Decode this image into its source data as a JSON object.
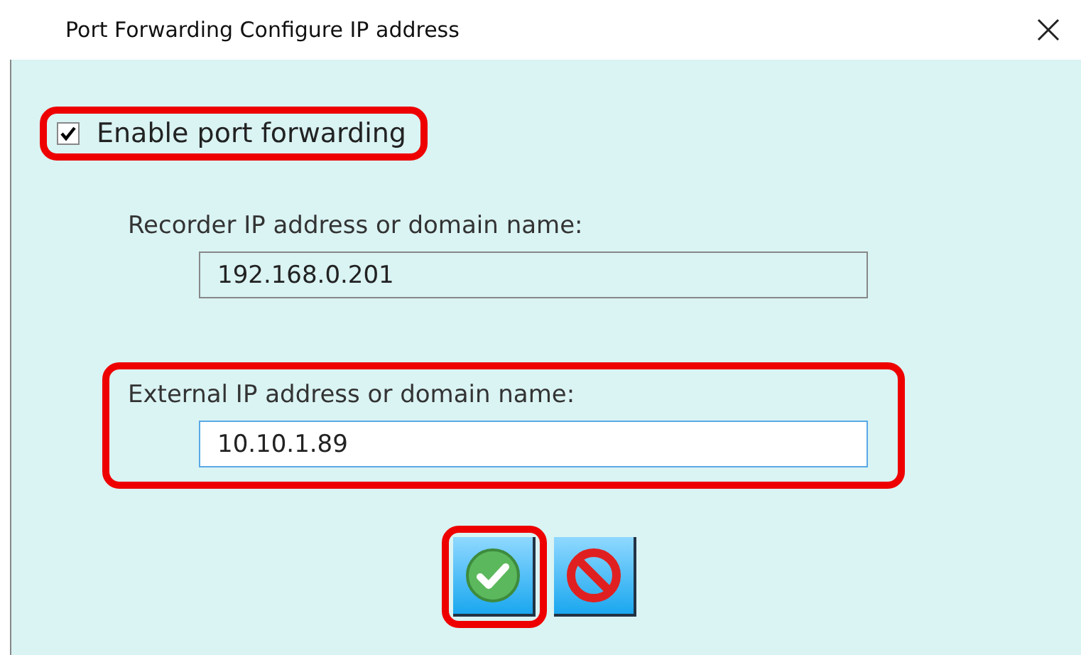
{
  "window": {
    "title": "Port Forwarding Configure IP address"
  },
  "enable_checkbox": {
    "label": "Enable port forwarding",
    "checked": true,
    "highlighted": true
  },
  "fields": [
    {
      "label": "Recorder IP address or domain name:",
      "value": "192.168.0.201",
      "focused": false,
      "highlighted": false
    },
    {
      "label": "External IP address or domain name:",
      "value": "10.10.1.89",
      "focused": true,
      "highlighted": true
    }
  ],
  "buttons": [
    {
      "kind": "ok",
      "highlighted": true
    },
    {
      "kind": "cancel",
      "highlighted": false
    }
  ]
}
